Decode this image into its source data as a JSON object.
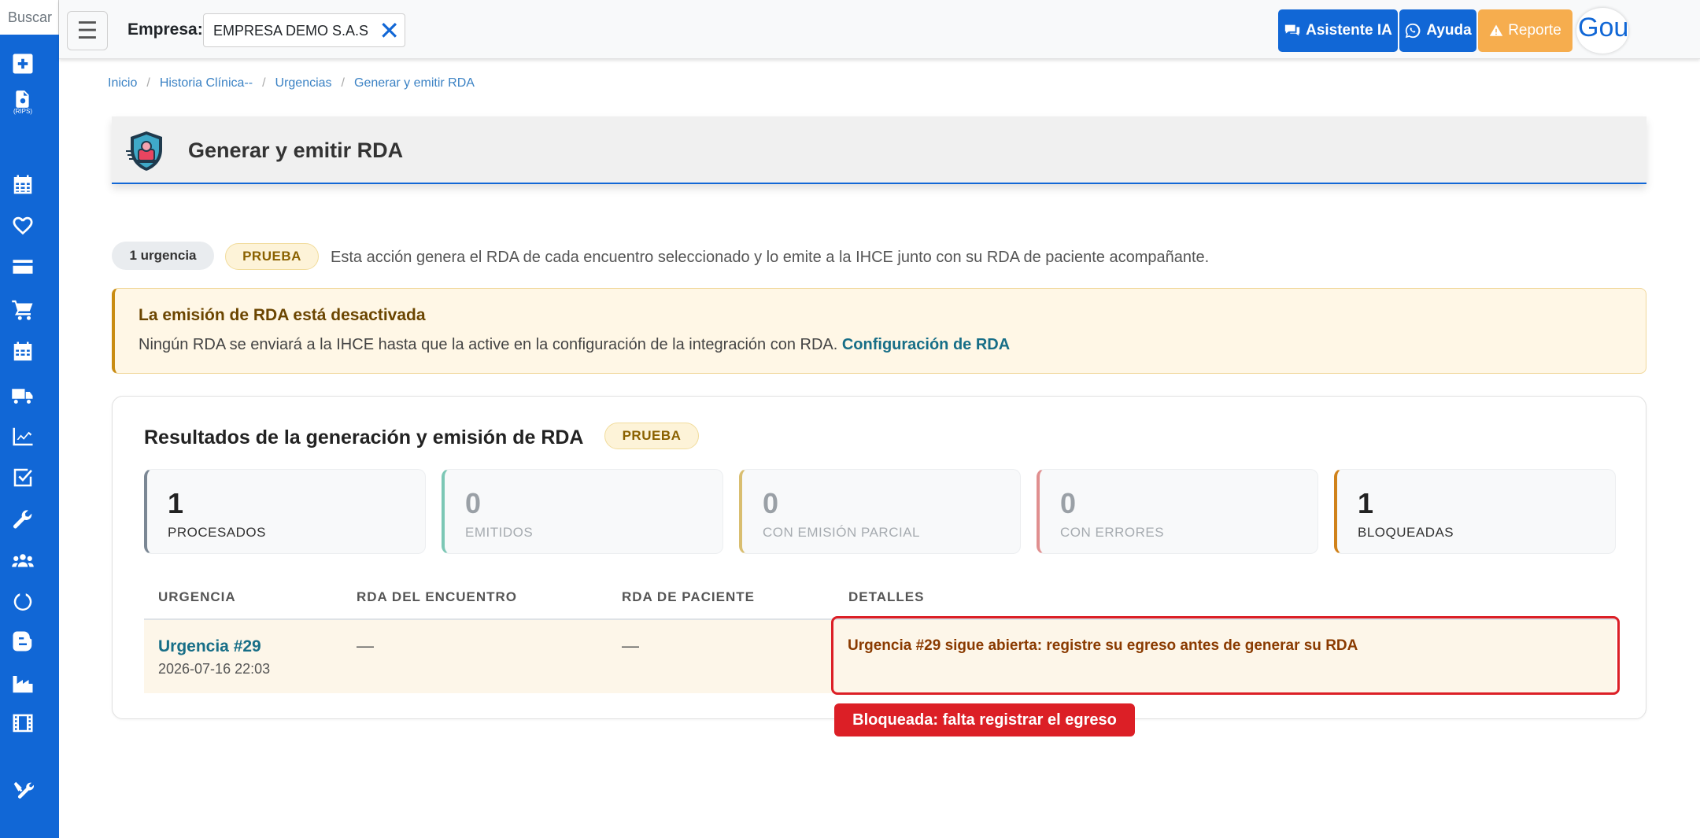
{
  "sidebar": {
    "search_placeholder": "Buscar",
    "icons": [
      "plus-square-icon",
      "rips-file-icon",
      "calendar-icon",
      "heart-icon",
      "credit-card-icon",
      "cart-icon",
      "calendar-alt-icon",
      "truck-icon",
      "chart-line-icon",
      "check-square-icon",
      "wrench-icon",
      "users-icon",
      "circle-notch-icon",
      "blogger-icon",
      "industry-icon",
      "film-icon",
      "tools-icon"
    ],
    "rips_label": "(RIPS)"
  },
  "topbar": {
    "empresa_label": "Empresa:",
    "empresa_value": "EMPRESA DEMO S.A.S",
    "clear_symbol": "✕",
    "btn_ia": "Asistente IA",
    "btn_ayuda": "Ayuda",
    "btn_reporte": "Reporte",
    "avatar_text": "Gou"
  },
  "breadcrumb": [
    "Inicio",
    "Historia Clínica--",
    "Urgencias",
    "Generar y emitir RDA"
  ],
  "page": {
    "title": "Generar y emitir RDA"
  },
  "info": {
    "count_pill": "1 urgencia",
    "mode_pill": "PRUEBA",
    "text": "Esta acción genera el RDA de cada encuentro seleccionado y lo emite a la IHCE junto con su RDA de paciente acompañante."
  },
  "alert": {
    "title": "La emisión de RDA está desactivada",
    "body": "Ningún RDA se enviará a la IHCE hasta que la active en la configuración de la integración con RDA.",
    "link": "Configuración de RDA"
  },
  "results": {
    "title": "Resultados de la generación y emisión de RDA",
    "mode_pill": "PRUEBA",
    "stats": [
      {
        "value": "1",
        "label": "PROCESADOS",
        "color": "#7b8794"
      },
      {
        "value": "0",
        "label": "EMITIDOS",
        "color": "#7cc7b5"
      },
      {
        "value": "0",
        "label": "CON EMISIÓN PARCIAL",
        "color": "#d9be70"
      },
      {
        "value": "0",
        "label": "CON ERRORES",
        "color": "#e08f8f"
      },
      {
        "value": "1",
        "label": "BLOQUEADAS",
        "color": "#d0821a"
      }
    ],
    "columns": [
      "URGENCIA",
      "RDA DEL ENCUENTRO",
      "RDA DE PACIENTE",
      "DETALLES"
    ],
    "rows": [
      {
        "urgencia": "Urgencia #29",
        "fecha": "2026-07-16 22:03",
        "rda_encuentro": "—",
        "rda_paciente": "—",
        "detalle": "Urgencia #29 sigue abierta: registre su egreso antes de generar su RDA"
      }
    ],
    "tooltip": "Bloqueada: falta registrar el egreso"
  }
}
